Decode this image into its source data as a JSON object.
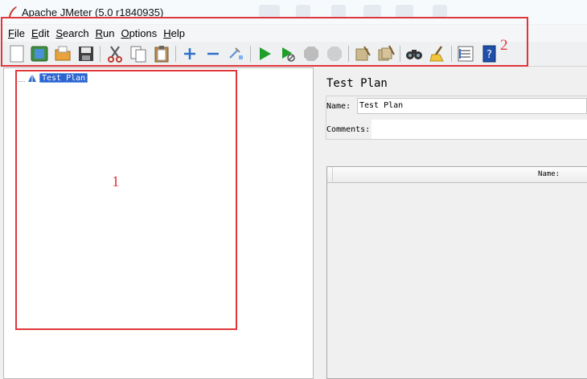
{
  "window": {
    "title": "Apache JMeter (5.0 r1840935)",
    "app_icon": "jmeter-feather-icon"
  },
  "menu": {
    "items": [
      {
        "mnemonic": "F",
        "rest": "ile"
      },
      {
        "mnemonic": "E",
        "rest": "dit"
      },
      {
        "mnemonic": "S",
        "rest": "earch"
      },
      {
        "mnemonic": "R",
        "rest": "un"
      },
      {
        "mnemonic": "O",
        "rest": "ptions"
      },
      {
        "mnemonic": "H",
        "rest": "elp"
      }
    ]
  },
  "toolbar": {
    "buttons": [
      "new-icon",
      "templates-icon",
      "open-icon",
      "save-icon",
      "cut-icon",
      "copy-icon",
      "paste-icon",
      "expand-icon",
      "collapse-icon",
      "toggle-icon",
      "start-icon",
      "start-no-pauses-icon",
      "stop-icon",
      "shutdown-icon",
      "clear-icon",
      "clear-all-icon",
      "search-icon",
      "reset-search-icon",
      "function-helper-icon",
      "help-icon"
    ]
  },
  "annotations": {
    "box1_label": "1",
    "box2_label": "2",
    "color": "#e0363a"
  },
  "tree": {
    "root_label": "Test Plan",
    "root_icon": "test-plan-icon",
    "selection_color": "#2c64d0"
  },
  "test_plan": {
    "heading": "Test Plan",
    "name_label": "Name:",
    "name_value": "Test Plan",
    "comments_label": "Comments:",
    "comments_value": "",
    "variables_table_header": "Name:"
  }
}
